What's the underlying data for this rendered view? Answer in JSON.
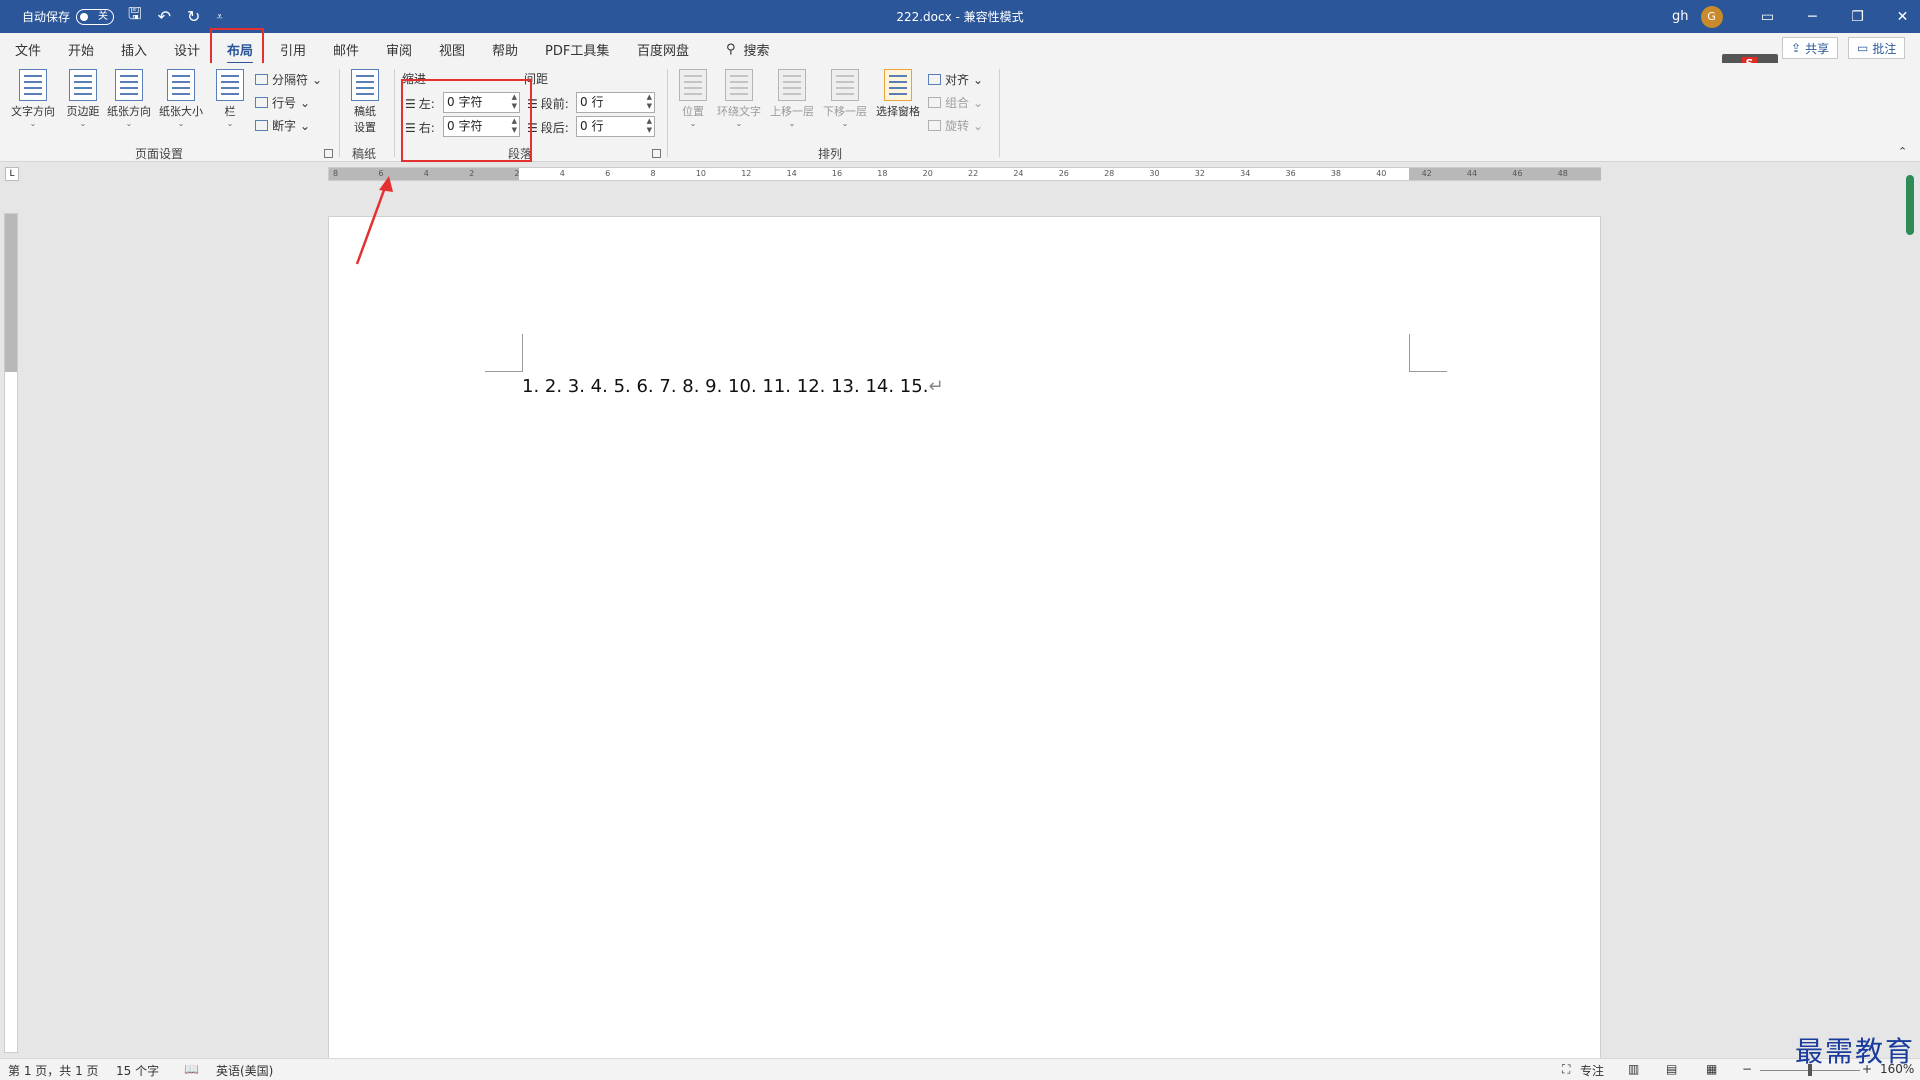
{
  "titlebar": {
    "autosave_label": "自动保存",
    "autosave_state": "关",
    "document_title": "222.docx  -  兼容性模式",
    "user": "gh",
    "avatar_initial": "G"
  },
  "tabs": [
    "文件",
    "开始",
    "插入",
    "设计",
    "布局",
    "引用",
    "邮件",
    "审阅",
    "视图",
    "帮助",
    "PDF工具集",
    "百度网盘"
  ],
  "active_tab": "布局",
  "search_label": "搜索",
  "share_label": "共享",
  "comment_label": "批注",
  "ribbon": {
    "page_setup": {
      "text_direction": "文字方向",
      "margins": "页边距",
      "orientation": "纸张方向",
      "size": "纸张大小",
      "columns": "栏",
      "breaks": "分隔符",
      "line_numbers": "行号",
      "hyphenation": "断字",
      "group_label": "页面设置"
    },
    "manuscript": {
      "button": "稿纸设置",
      "button_line1": "稿纸",
      "button_line2": "设置",
      "group_label": "稿纸"
    },
    "paragraph": {
      "indent_header": "缩进",
      "spacing_header": "间距",
      "left_label": "左:",
      "left_value": "0 字符",
      "right_label": "右:",
      "right_value": "0 字符",
      "before_label": "段前:",
      "before_value": "0 行",
      "after_label": "段后:",
      "after_value": "0 行",
      "group_label": "段落"
    },
    "arrange": {
      "position": "位置",
      "wrap_text": "环绕文字",
      "bring_forward": "上移一层",
      "send_backward": "下移一层",
      "selection_pane": "选择窗格",
      "align": "对齐",
      "group": "组合",
      "rotate": "旋转",
      "group_label": "排列"
    }
  },
  "hruler_ticks": [
    "8",
    "6",
    "4",
    "2",
    "2",
    "4",
    "6",
    "8",
    "10",
    "12",
    "14",
    "16",
    "18",
    "20",
    "22",
    "24",
    "26",
    "28",
    "30",
    "32",
    "34",
    "36",
    "38",
    "40",
    "42",
    "44",
    "46",
    "48"
  ],
  "document": {
    "text": "1. 2. 3. 4. 5. 6. 7. 8. 9. 10. 11. 12. 13. 14. 15.",
    "paragraph_mark": "↵"
  },
  "status": {
    "page": "第 1 页，共 1 页",
    "words": "15 个字",
    "language": "英语(美国)",
    "focus": "专注",
    "zoom": "160%"
  },
  "watermark": "最需教育",
  "colors": {
    "title_bar": "#2b579a",
    "highlight": "#e53030",
    "arrow": "#e53030"
  }
}
